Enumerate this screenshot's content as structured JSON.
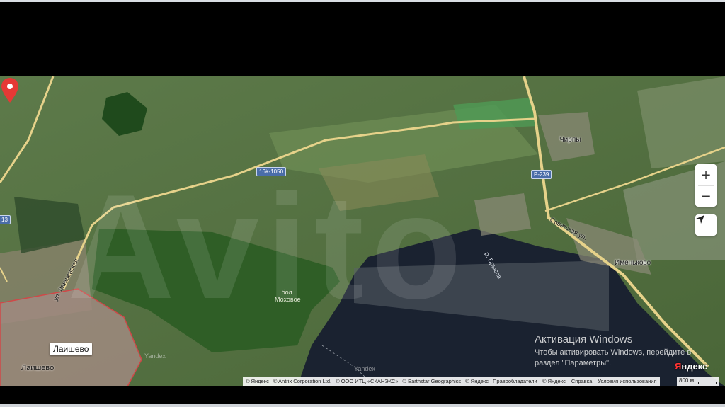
{
  "map": {
    "watermark": "Avito",
    "road_labels": [
      "16К-1050",
      "Р-239",
      "13"
    ],
    "places": {
      "chirpy": "Чирпы",
      "imenkovo": "Именьково",
      "laishevo": "Лаишево",
      "street_sovetskaya": "Советская ул.",
      "street_laish": "ул. Лаишевская",
      "marsh": "бол.\nМоховое",
      "river": "р. Брысса"
    },
    "tile_marks": [
      "Yandex",
      "Yandex"
    ],
    "pin": {
      "label": "Лаишево",
      "sub_label": "Лаишево",
      "color": "#e53935"
    }
  },
  "controls": {
    "zoom_in": "+",
    "zoom_out": "−",
    "locate_icon": "navigation-arrow-icon"
  },
  "activation": {
    "title": "Активация Windows",
    "line1": "Чтобы активировать Windows, перейдите в",
    "line2": "раздел \"Параметры\"."
  },
  "attribution": {
    "items": [
      "© Яндекс",
      "© Antrix Corporation Ltd.",
      "© ООО ИТЦ «СКАНЭКС»",
      "© Earthstar Geographics",
      "© Яндекс",
      "Правообладатели"
    ],
    "right_items": [
      "© Яндекс",
      "Справка",
      "Условия использования"
    ],
    "logo_prefix": "Я",
    "logo_rest": "ндекс",
    "scale": "800 м"
  },
  "colors": {
    "water": "#1a2230",
    "forest": "#2f5e26",
    "road": "#e6d28a"
  }
}
